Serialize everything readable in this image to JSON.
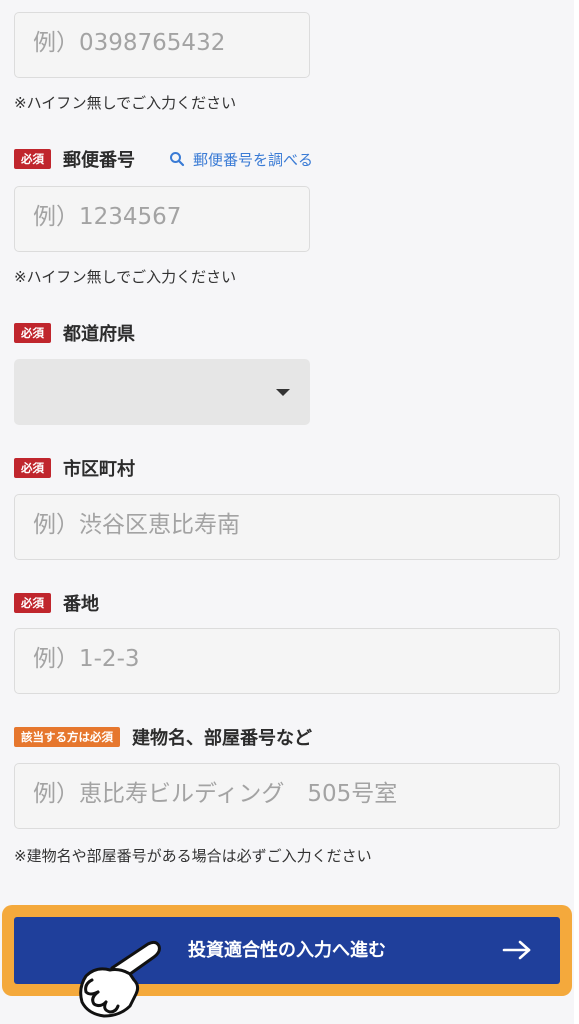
{
  "phone": {
    "placeholder": "例）0398765432",
    "note": "※ハイフン無しでご入力ください"
  },
  "postal": {
    "badge": "必須",
    "label": "郵便番号",
    "lookup_link": "郵便番号を調べる",
    "placeholder": "例）1234567",
    "note": "※ハイフン無しでご入力ください"
  },
  "prefecture": {
    "badge": "必須",
    "label": "都道府県",
    "value": ""
  },
  "city": {
    "badge": "必須",
    "label": "市区町村",
    "placeholder": "例）渋谷区恵比寿南"
  },
  "address": {
    "badge": "必須",
    "label": "番地",
    "placeholder": "例）1-2-3"
  },
  "building": {
    "badge": "該当する方は必須",
    "label": "建物名、部屋番号など",
    "placeholder": "例）恵比寿ビルディング　505号室",
    "note": "※建物名や部屋番号がある場合は必ずご入力ください"
  },
  "submit": {
    "label": "投資適合性の入力へ進む",
    "icon": "arrow-right-icon"
  },
  "colors": {
    "required_badge": "#c0262d",
    "conditional_badge": "#e6772e",
    "cta_background": "#1f3f9b",
    "cta_highlight": "#f4a93c",
    "link": "#3a7bd5"
  }
}
